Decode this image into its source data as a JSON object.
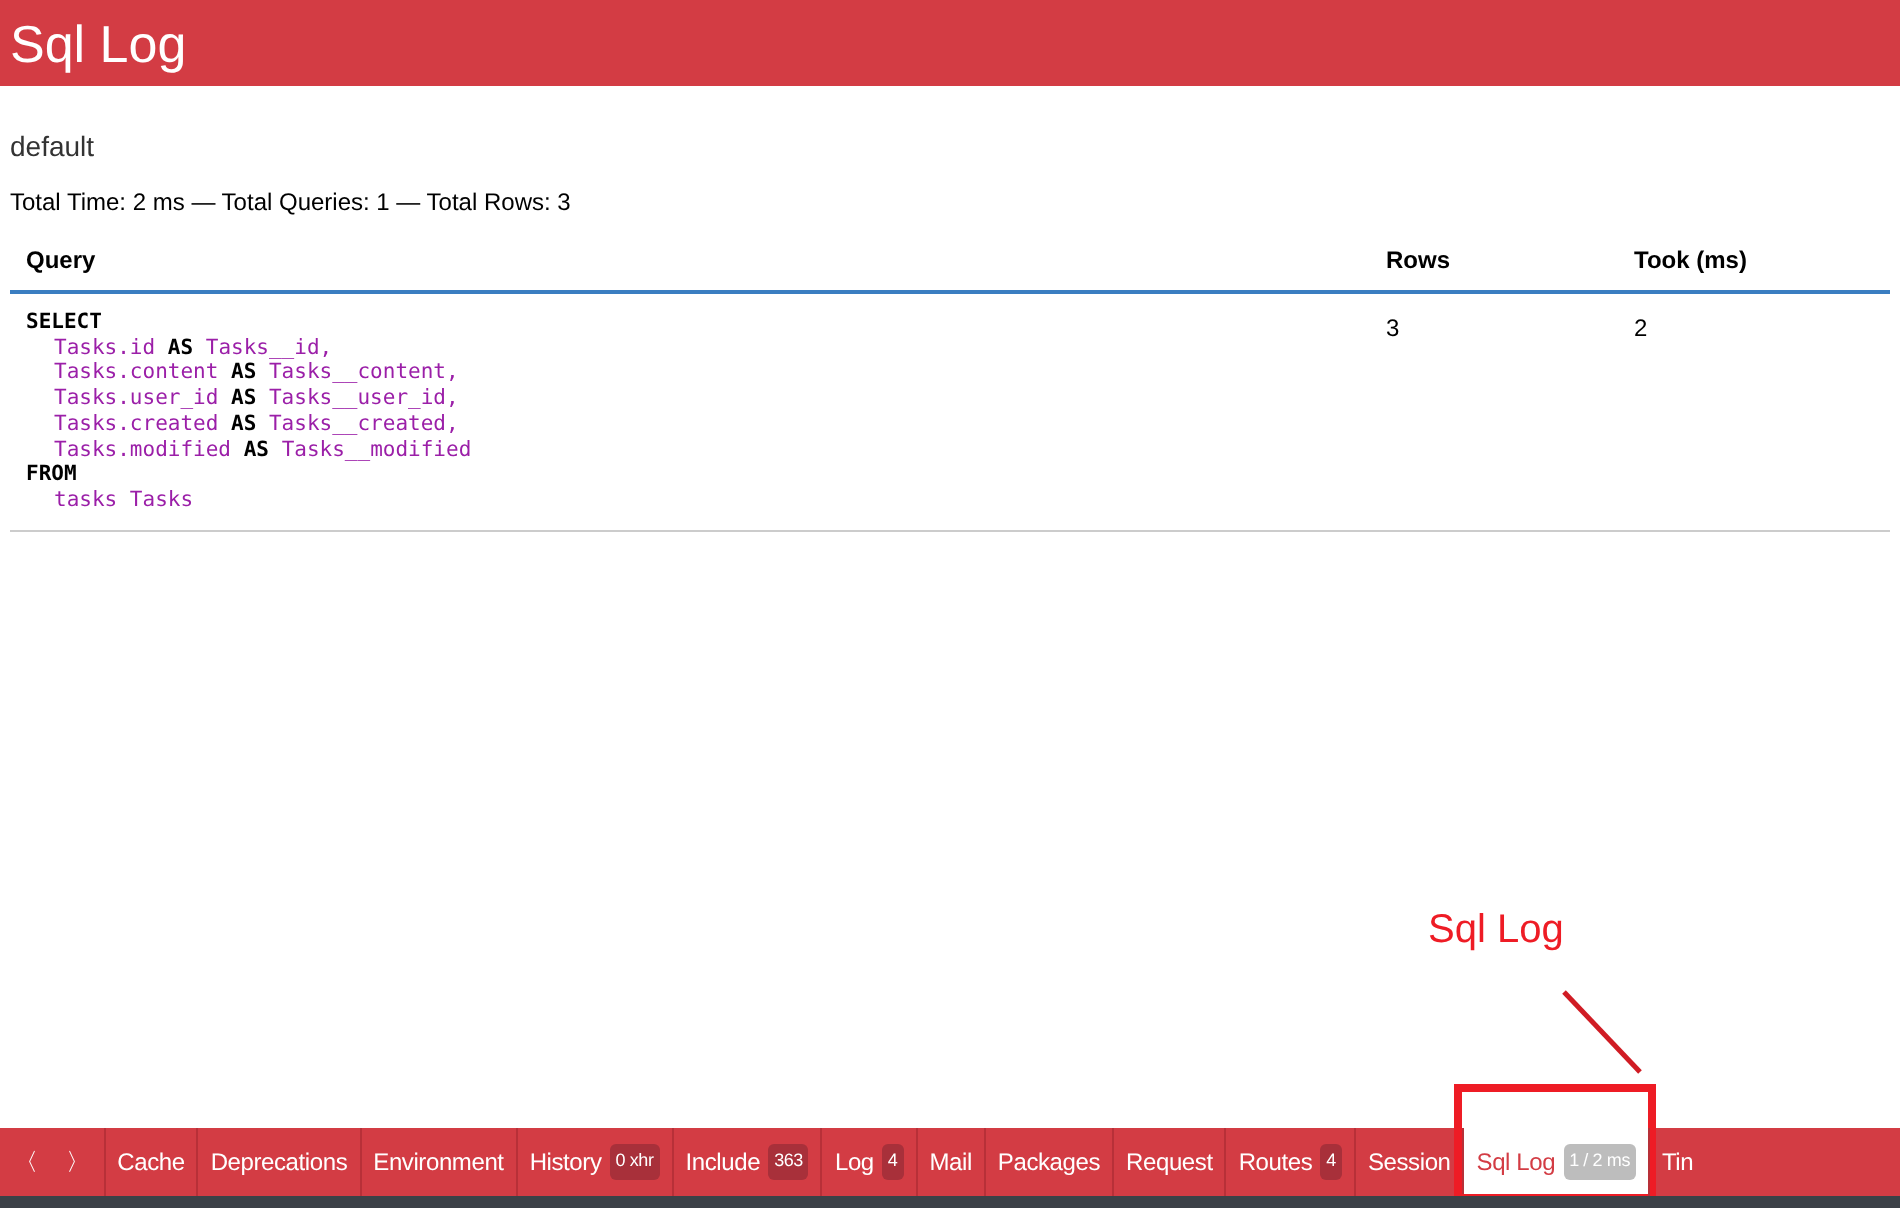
{
  "header": {
    "title": "Sql Log"
  },
  "connection": "default",
  "summary": "Total Time: 2 ms — Total Queries: 1 — Total Rows: 3",
  "table": {
    "columns": [
      "Query",
      "Rows",
      "Took (ms)"
    ],
    "rows": [
      {
        "query": [
          {
            "keyword": "SELECT",
            "lines": [
              [
                {
                  "text": "Tasks.id",
                  "kind": "ident"
                },
                {
                  "text": " AS ",
                  "kind": "keyword"
                },
                {
                  "text": "Tasks__id,",
                  "kind": "ident"
                }
              ],
              [
                {
                  "text": "Tasks.content",
                  "kind": "ident"
                },
                {
                  "text": " AS ",
                  "kind": "keyword"
                },
                {
                  "text": "Tasks__content,",
                  "kind": "ident"
                }
              ],
              [
                {
                  "text": "Tasks.user_id",
                  "kind": "ident"
                },
                {
                  "text": " AS ",
                  "kind": "keyword"
                },
                {
                  "text": "Tasks__user_id,",
                  "kind": "ident"
                }
              ],
              [
                {
                  "text": "Tasks.created",
                  "kind": "ident"
                },
                {
                  "text": " AS ",
                  "kind": "keyword"
                },
                {
                  "text": "Tasks__created,",
                  "kind": "ident"
                }
              ],
              [
                {
                  "text": "Tasks.modified",
                  "kind": "ident"
                },
                {
                  "text": " AS ",
                  "kind": "keyword"
                },
                {
                  "text": "Tasks__modified",
                  "kind": "ident"
                }
              ]
            ]
          },
          {
            "keyword": "FROM",
            "lines": [
              [
                {
                  "text": "tasks Tasks",
                  "kind": "ident"
                }
              ]
            ]
          }
        ],
        "rows": "3",
        "took": "2"
      }
    ]
  },
  "annotation": {
    "label": "Sql Log"
  },
  "toolbar": {
    "nav": [
      "〈",
      "〉"
    ],
    "tabs": [
      {
        "label": "Cache",
        "selected": false
      },
      {
        "label": "Deprecations",
        "selected": false
      },
      {
        "label": "Environment",
        "selected": false
      },
      {
        "label": "History",
        "badge": "0 xhr",
        "selected": false
      },
      {
        "label": "Include",
        "badge": "363",
        "selected": false
      },
      {
        "label": "Log",
        "badge": "4",
        "selected": false
      },
      {
        "label": "Mail",
        "selected": false
      },
      {
        "label": "Packages",
        "selected": false
      },
      {
        "label": "Request",
        "selected": false
      },
      {
        "label": "Routes",
        "badge": "4",
        "selected": false
      },
      {
        "label": "Session",
        "selected": false
      },
      {
        "label": "Sql Log",
        "badge": "1 / 2 ms",
        "selected": true
      },
      {
        "label": "Tin",
        "selected": false
      }
    ]
  }
}
